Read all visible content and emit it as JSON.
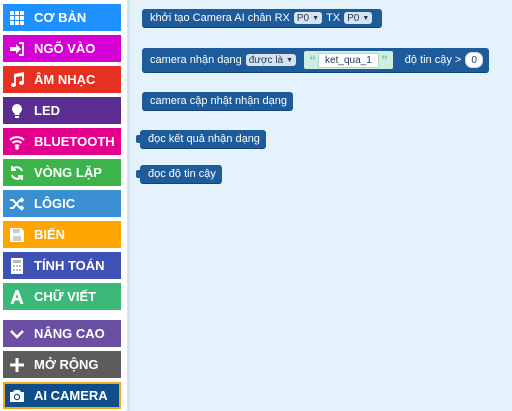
{
  "sidebar": {
    "items": [
      {
        "label": "CƠ BẢN",
        "color": "#1e90ff",
        "icon": "grid-icon"
      },
      {
        "label": "NGÕ VÀO",
        "color": "#d400d4",
        "icon": "sign-in-icon"
      },
      {
        "label": "ÂM NHẠC",
        "color": "#e63022",
        "icon": "music-note-icon"
      },
      {
        "label": "LED",
        "color": "#5c2d91",
        "icon": "lightbulb-icon"
      },
      {
        "label": "BLUETOOTH",
        "color": "#e3008c",
        "icon": "wifi-icon"
      },
      {
        "label": "VÒNG LẶP",
        "color": "#00aa00",
        "icon": "refresh-icon"
      },
      {
        "label": "LÔGIC",
        "color": "#00a4a6",
        "icon": "shuffle-icon"
      },
      {
        "label": "BIẾN",
        "color": "#dc143c",
        "icon": "save-icon"
      },
      {
        "label": "TÍNH TOÁN",
        "color": "#9400d3",
        "icon": "calculator-icon"
      },
      {
        "label": "CHỮ VIẾT",
        "color": "#996600",
        "icon": "text-a-icon"
      },
      {
        "label": "NÂNG CAO",
        "color": "#3c3c3c",
        "icon": "chevron-down-icon"
      },
      {
        "label": "MỞ RỘNG",
        "color": "#3c3c3c",
        "icon": "plus-icon"
      },
      {
        "label": "AI CAMERA",
        "color": "#0f4e8a",
        "icon": "camera-icon"
      }
    ]
  },
  "blocks": {
    "camera_init": {
      "text": "khởi tạo Camera AI chân RX",
      "rx": "P0",
      "tx_label": "TX",
      "tx": "P0"
    },
    "camera_detect": {
      "text": "camera nhận dạng",
      "op": "được là",
      "str": "ket_qua_1",
      "conf_label": "độ tin cậy >",
      "conf": "0"
    },
    "camera_update": {
      "text": "camera cập nhật nhận dạng"
    },
    "read_result": {
      "text": "đọc kết quả nhận dạng"
    },
    "read_conf": {
      "text": "đọc độ tin cậy"
    }
  }
}
